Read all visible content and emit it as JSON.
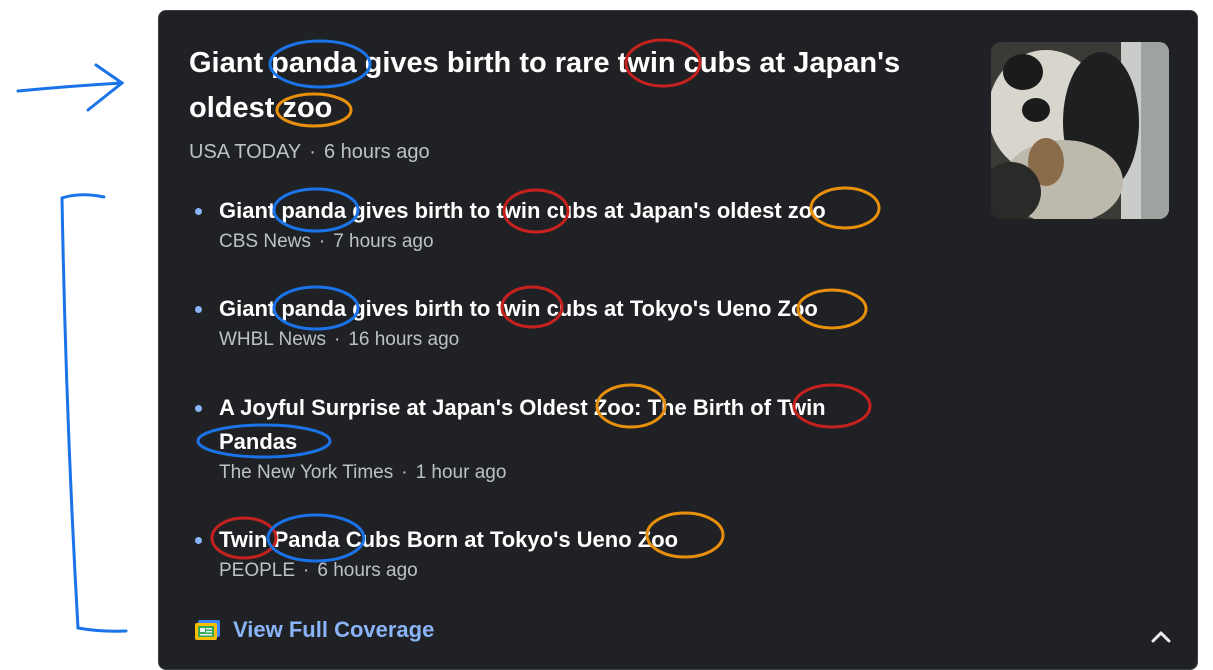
{
  "headline": {
    "title": "Giant panda gives birth to rare twin cubs at Japan's oldest zoo",
    "source": "USA TODAY",
    "time": "6 hours ago"
  },
  "thumbnail_icon": "panda-photo",
  "stories": [
    {
      "title": "Giant panda gives birth to twin cubs at Japan's oldest zoo",
      "source": "CBS News",
      "time": "7 hours ago"
    },
    {
      "title": "Giant panda gives birth to twin cubs at Tokyo's Ueno Zoo",
      "source": "WHBL News",
      "time": "16 hours ago"
    },
    {
      "title": "A Joyful Surprise at Japan's Oldest Zoo: The Birth of Twin Pandas",
      "source": "The New York Times",
      "time": "1 hour ago"
    },
    {
      "title": "Twin Panda Cubs Born at Tokyo's Ueno Zoo",
      "source": "PEOPLE",
      "time": "6 hours ago"
    }
  ],
  "footer": {
    "coverage_label": "View Full Coverage",
    "coverage_icon": "newspaper-icon",
    "collapse_icon": "chevron-up-icon"
  },
  "colors": {
    "card_bg": "#202124",
    "link_blue": "#8ab4f8",
    "annotation_blue": "#1a73e8",
    "annotation_red": "#c5221f",
    "annotation_orange": "#e8900c"
  }
}
